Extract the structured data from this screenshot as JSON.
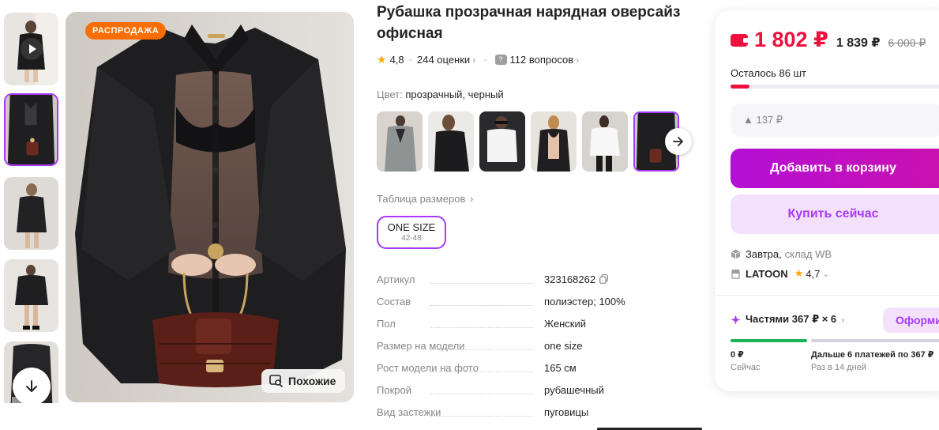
{
  "gallery": {
    "sale_badge": "РАСПРОДАЖА",
    "similar_label": "Похожие"
  },
  "product": {
    "title": "Рубашка прозрачная нарядная оверсайз офисная",
    "rating": "4,8",
    "reviews": "244 оценки",
    "questions": "112 вопросов"
  },
  "color": {
    "label": "Цвет:",
    "value": "прозрачный, черный"
  },
  "sizes": {
    "table_link": "Таблица размеров",
    "selected": "ONE SIZE",
    "selected_range": "42-48"
  },
  "specs": [
    {
      "key": "Артикул",
      "value": "323168262"
    },
    {
      "key": "Состав",
      "value": "полиэстер; 100%"
    },
    {
      "key": "Пол",
      "value": "Женский"
    },
    {
      "key": "Размер на модели",
      "value": "one size"
    },
    {
      "key": "Рост модели на фото",
      "value": "165 см"
    },
    {
      "key": "Покрой",
      "value": "рубашечный"
    },
    {
      "key": "Вид застежки",
      "value": "пуговицы"
    }
  ],
  "buy_panel": {
    "price_wallet": "1 802 ₽",
    "price_regular": "1 839 ₽",
    "price_old": "6 000 ₽",
    "stock_text": "Осталось 86 шт",
    "stock_fraction": 0.09,
    "price_delta": "▲ 137 ₽",
    "add_to_cart": "Добавить в корзину",
    "buy_now": "Купить сейчас",
    "delivery_date": "Завтра,",
    "delivery_warehouse": "склад WB",
    "seller_name": "LATOON",
    "seller_rating": "4,7",
    "installments": "Частями 367 ₽ × 6",
    "installments_button": "Оформи",
    "first_payment": "0 ₽",
    "first_payment_when": "Сейчас",
    "next_payments": "Дальше 6 платежей по 367 ₽",
    "next_payments_when": "Раз в 14 дней"
  },
  "colors": {
    "accent": "#a73afd",
    "brand": "#cb11ab",
    "price_red": "#f0103e",
    "sale_orange": "#f96e04",
    "star": "#ffa600"
  }
}
